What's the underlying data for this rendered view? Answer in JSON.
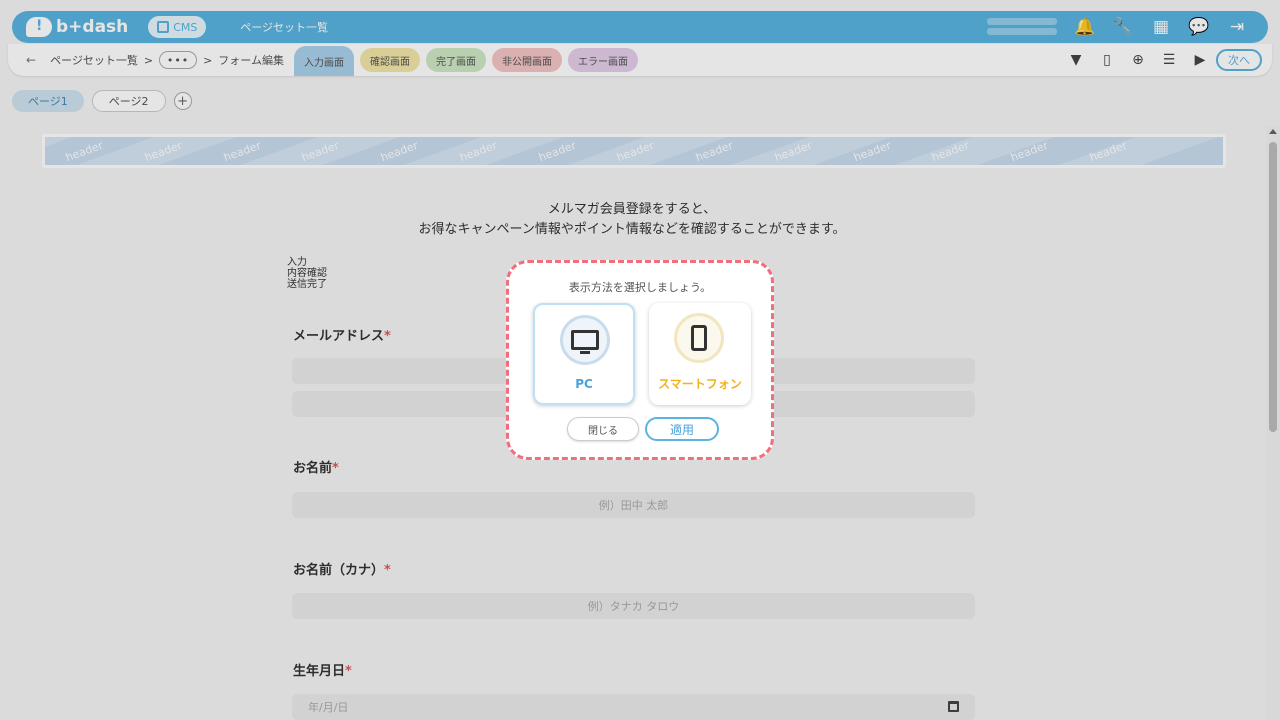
{
  "app": {
    "logo_text": "b+dash",
    "cms_label": "CMS",
    "title": "ページセット一覧"
  },
  "subbar": {
    "back_label": "←",
    "breadcrumb_root": "ページセット一覧",
    "breadcrumb_sep": ">",
    "breadcrumb_more": "•••",
    "breadcrumb_current": "フォーム編集",
    "tabs": [
      "入力画面",
      "確認画面",
      "完了画面",
      "非公開画面",
      "エラー画面"
    ],
    "next_label": "次へ"
  },
  "page_tabs": {
    "items": [
      "ページ1",
      "ページ2"
    ],
    "add_label": "+"
  },
  "header_banner": {
    "text": "header"
  },
  "form": {
    "intro_line1": "メルマガ会員登録をすると、",
    "intro_line2": "お得なキャンペーン情報やポイント情報などを確認することができます。",
    "steps": [
      "入力",
      "内容確認",
      "送信完了"
    ],
    "email_label": "メールアドレス",
    "name_label": "お名前",
    "name_placeholder": "例）田中 太郎",
    "kana_label": "お名前（カナ）",
    "kana_placeholder": "例）タナカ タロウ",
    "birth_label": "生年月日",
    "birth_placeholder": "年/月/日",
    "required_mark": "*"
  },
  "dialog": {
    "title": "表示方法を選択しましょう。",
    "options": [
      {
        "label": "PC",
        "icon": "monitor-icon",
        "selected": true
      },
      {
        "label": "スマートフォン",
        "icon": "smartphone-icon",
        "selected": false
      }
    ],
    "close_label": "閉じる",
    "apply_label": "適用"
  },
  "colors": {
    "accent": "#5ab4e0",
    "dialog_border": "#ef6f7c",
    "sp_accent": "#f0b31c",
    "required": "#e05a5a"
  }
}
